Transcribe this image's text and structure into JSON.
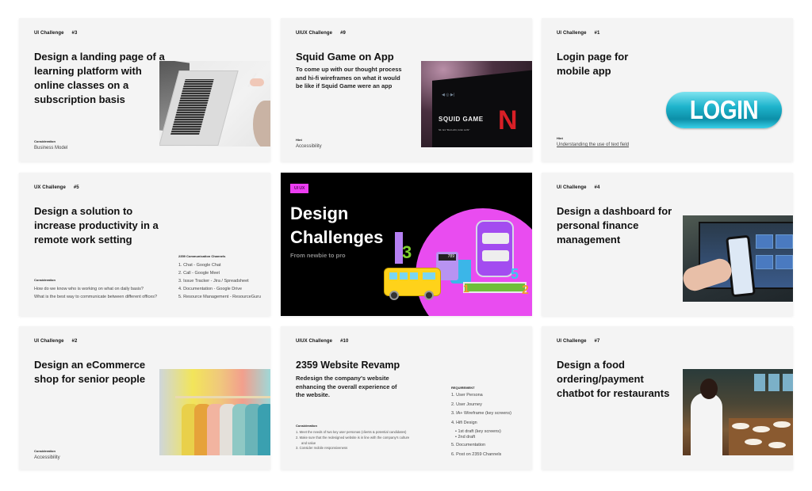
{
  "cards": [
    {
      "category": "UI Challenge",
      "number": "#3",
      "title": "Design a landing page of a learning platform with online classes on a subscription basis",
      "footer_label": "Consideration",
      "footer_value": "Business Model",
      "image": "laptop-desk-photo"
    },
    {
      "category": "UIUX Challenge",
      "number": "#9",
      "title": "Squid Game on App",
      "subtitle": "To come up with our thought process and hi-fi wireframes on what it would be like if Squid Game were an app",
      "footer_label": "Hint",
      "footer_value": "Accessibility",
      "image": "squid-game-netflix-photo",
      "image_text": {
        "show": "SQUID GAME",
        "brand": "N",
        "caption": "S1: E1 \"Rot Licht, Grün Licht\""
      }
    },
    {
      "category": "UI Challenge",
      "number": "#1",
      "title": "Login page for mobile app",
      "footer_label": "Hint",
      "footer_value": "Understanding the use of text field",
      "image": "login-button-graphic",
      "button_text": "LOGIN"
    },
    {
      "category": "UX Challenge",
      "number": "#5",
      "title": "Design a solution to increase productivity in a remote work setting",
      "list_heading": "2359 Communication Channels",
      "list": [
        "1. Chat - Google Chat",
        "2. Call - Google Meet",
        "3. Issue Tracker - Jira / Spreadsheet",
        "4. Documentation - Google Drive",
        "5. Resource Management - ResourceGuru"
      ],
      "footer_label": "Consideration",
      "questions": [
        "How do we know who is working on what on daily basis?",
        "What is the best way to communicate between different offices?"
      ]
    },
    {
      "pill": "UI UX",
      "title_line1": "Design",
      "title_line2": "Challenges",
      "subtitle": "From newbie to pro",
      "image": "3d-school-supplies-illustration",
      "calc_display": "789",
      "numbers": [
        "3",
        "1",
        "5",
        "2"
      ],
      "accent": "#ec3df2"
    },
    {
      "category": "UI Challenge",
      "number": "#4",
      "title": "Design a dashboard for personal finance management",
      "image": "finance-dashboard-phone-photo"
    },
    {
      "category": "UI Challenge",
      "number": "#2",
      "title": "Design an eCommerce shop for senior people",
      "footer_label": "Consideration",
      "footer_value": "Accessibility",
      "image": "clothes-rack-photo"
    },
    {
      "category": "UIUX Challenge",
      "number": "#10",
      "title": "2359 Website Revamp",
      "subtitle": "Redesign the company's website enhancing the overall experience of the website.",
      "consideration_label": "Consideration",
      "considerations": [
        "1. Meet the needs of two key user personas (clients & potential candidates)",
        "2. Make sure that the redesigned website is in line with the company's culture and value",
        "3. Consider mobile responsiveness"
      ],
      "requirement_label": "REQUIREMENT",
      "requirements": [
        "1. User Persona",
        "2. User Journey",
        "3. IA+ Wireframe (key screens)",
        "4. Hifi Design",
        "5. Documentation",
        "6. Post on 2359 Channels"
      ],
      "hifi_sub": [
        "• 1st draft (key screens)",
        "• 2nd draft"
      ]
    },
    {
      "category": "UI Challenge",
      "number": "#7",
      "title": "Design a food ordering/payment chatbot for restaurants",
      "image": "restaurant-dining-photo"
    }
  ]
}
